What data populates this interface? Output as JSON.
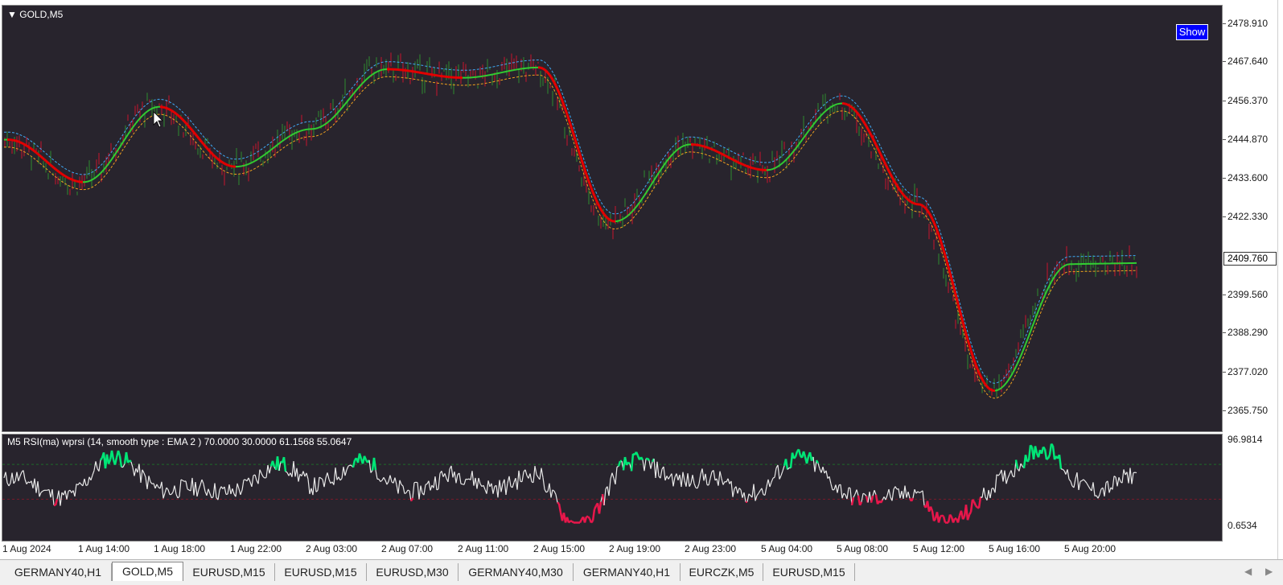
{
  "chart": {
    "symbol": "GOLD,M5",
    "show_button": "Show",
    "indicator_title": "M5 RSI(ma) wprsi (14, smooth type : EMA  2 ) 70.0000 30.0000 61.1568 55.0647",
    "current_price": "2409.760",
    "price_ticks": [
      "2478.910",
      "2467.640",
      "2456.370",
      "2444.870",
      "2433.600",
      "2422.330",
      "2409.760",
      "2399.560",
      "2388.290",
      "2377.020",
      "2365.750"
    ],
    "indicator_ticks": [
      "96.9814",
      "0.6534"
    ],
    "time_ticks": [
      "1 Aug 2024",
      "1 Aug 14:00",
      "1 Aug 18:00",
      "1 Aug 22:00",
      "2 Aug 03:00",
      "2 Aug 07:00",
      "2 Aug 11:00",
      "2 Aug 15:00",
      "2 Aug 19:00",
      "2 Aug 23:00",
      "5 Aug 04:00",
      "5 Aug 08:00",
      "5 Aug 12:00",
      "5 Aug 16:00",
      "5 Aug 20:00"
    ],
    "colors": {
      "background": "#28242d",
      "candle_up": "#2e8b2e",
      "candle_down": "#c8142d",
      "ma_up": "#32cd32",
      "ma_down": "#e60000",
      "band_upper": "#3fa9f5",
      "band_lower": "#f0a01e",
      "rsi_neutral": "#e8e8e8",
      "rsi_high": "#00e676",
      "rsi_low": "#e8174b"
    }
  },
  "chart_data": {
    "type": "line",
    "x": [
      "1 Aug 2024",
      "1 Aug 14:00",
      "1 Aug 18:00",
      "1 Aug 22:00",
      "2 Aug 03:00",
      "2 Aug 07:00",
      "2 Aug 11:00",
      "2 Aug 15:00",
      "2 Aug 19:00",
      "2 Aug 23:00",
      "5 Aug 04:00",
      "5 Aug 08:00",
      "5 Aug 12:00",
      "5 Aug 16:00",
      "5 Aug 20:00"
    ],
    "ylim": [
      2363,
      2482
    ],
    "series": [
      {
        "values": [
          2444.9,
          2432.5,
          2454.5,
          2437.0,
          2448.0,
          2465.5,
          2463.0,
          2466.0,
          2421.0,
          2443.5,
          2436.0,
          2455.5,
          2426.0,
          2371.5,
          2408.5
        ]
      }
    ],
    "indicator": {
      "levels": [
        70,
        30
      ],
      "values": [
        61.1568,
        55.0647
      ],
      "ylim": [
        0.6534,
        96.9814
      ]
    }
  },
  "tabs": [
    "GERMANY40,H1",
    "GOLD,M5",
    "EURUSD,M15",
    "EURUSD,M15",
    "EURUSD,M30",
    "GERMANY40,M30",
    "GERMANY40,H1",
    "EURCZK,M5",
    "EURUSD,M15"
  ],
  "active_tab": "GOLD,M5"
}
